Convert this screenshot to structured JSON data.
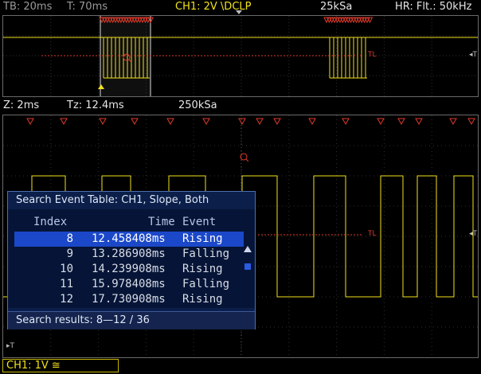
{
  "header": {
    "tb": "TB: 20ms",
    "t": "T: 70ms",
    "ch1": "CH1: 2V \\DCLP",
    "rate": "25kSa",
    "hr": "HR: Flt.: 50kHz"
  },
  "zoom_header": {
    "z": "Z: 2ms",
    "tz": "Tz: 12.4ms",
    "rate": "250kSa"
  },
  "markers": {
    "tl": "TL",
    "t_arrow": "◂T",
    "t_bottom": "▸T"
  },
  "dialog": {
    "title": "Search Event Table: CH1, Slope, Both",
    "columns": {
      "index": "Index",
      "time": "Time",
      "event": "Event"
    },
    "rows": [
      {
        "index": "8",
        "time": "12.458408ms",
        "event": "Rising",
        "selected": true
      },
      {
        "index": "9",
        "time": "13.286908ms",
        "event": "Falling",
        "selected": false
      },
      {
        "index": "10",
        "time": "14.239908ms",
        "event": "Rising",
        "selected": false
      },
      {
        "index": "11",
        "time": "15.978408ms",
        "event": "Falling",
        "selected": false
      },
      {
        "index": "12",
        "time": "17.730908ms",
        "event": "Rising",
        "selected": false
      }
    ],
    "footer": "Search results:  8—12 / 36",
    "scroll_up_icon": "up-arrow-icon",
    "scroll_down_icon": "down-arrow-icon"
  },
  "status": {
    "ch1": "CH1: 1V ≅"
  },
  "colors": {
    "trace": "#f2e21a",
    "marker": "#e03a2a",
    "dialog_bg": "#0b1f4a",
    "selection": "#1b48c8"
  }
}
